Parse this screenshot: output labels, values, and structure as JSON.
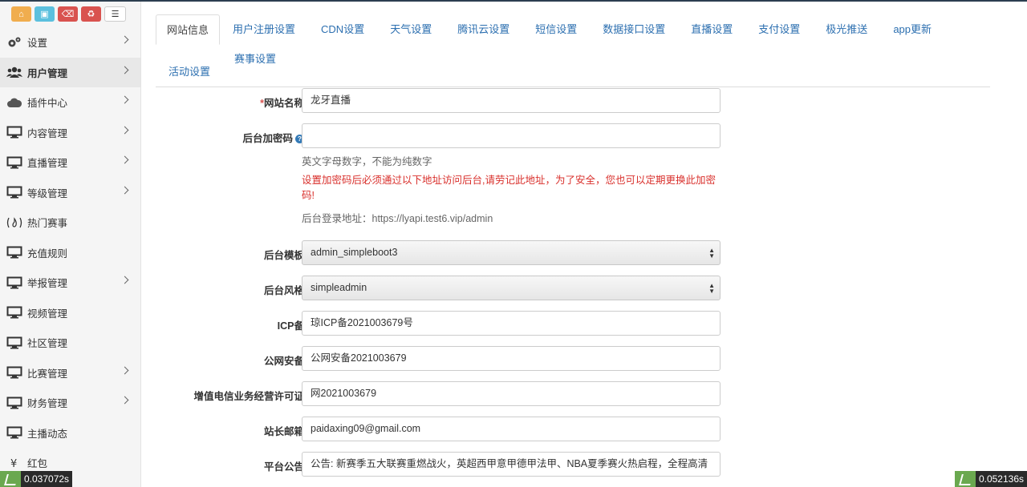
{
  "sidebar": {
    "items": [
      {
        "label": "设置",
        "icon": "gears-icon",
        "arrow": true,
        "active": false
      },
      {
        "label": "用户管理",
        "icon": "users-icon",
        "arrow": true,
        "active": true
      },
      {
        "label": "插件中心",
        "icon": "cloud-icon",
        "arrow": true,
        "active": false
      },
      {
        "label": "内容管理",
        "icon": "monitor-icon",
        "arrow": true,
        "active": false
      },
      {
        "label": "直播管理",
        "icon": "monitor-icon",
        "arrow": true,
        "active": false
      },
      {
        "label": "等级管理",
        "icon": "monitor-icon",
        "arrow": true,
        "active": false
      },
      {
        "label": "热门赛事",
        "icon": "fire-icon",
        "arrow": false,
        "active": false
      },
      {
        "label": "充值规则",
        "icon": "monitor-icon",
        "arrow": false,
        "active": false
      },
      {
        "label": "举报管理",
        "icon": "monitor-icon",
        "arrow": true,
        "active": false
      },
      {
        "label": "视频管理",
        "icon": "monitor-icon",
        "arrow": false,
        "active": false
      },
      {
        "label": "社区管理",
        "icon": "monitor-icon",
        "arrow": false,
        "active": false
      },
      {
        "label": "比赛管理",
        "icon": "monitor-icon",
        "arrow": true,
        "active": false
      },
      {
        "label": "财务管理",
        "icon": "monitor-icon",
        "arrow": true,
        "active": false
      },
      {
        "label": "主播动态",
        "icon": "monitor-icon",
        "arrow": false,
        "active": false
      },
      {
        "label": "红包",
        "icon": "yen-icon",
        "arrow": false,
        "active": false
      }
    ]
  },
  "tabs": [
    "网站信息",
    "用户注册设置",
    "CDN设置",
    "天气设置",
    "腾讯云设置",
    "短信设置",
    "数据接口设置",
    "直播设置",
    "支付设置",
    "极光推送",
    "app更新",
    "活动设置",
    "赛事设置"
  ],
  "form": {
    "site_name": {
      "required_mark": "*",
      "label": "网站名称",
      "value": "龙牙直播"
    },
    "admin_password": {
      "label": "后台加密码",
      "value": "",
      "help": "英文字母数字，不能为纯数字",
      "warning": "设置加密码后必须通过以下地址访问后台,请劳记此地址，为了安全，您也可以定期更换此加密码!",
      "login_url": "后台登录地址：https://lyapi.test6.vip/admin"
    },
    "admin_template": {
      "label": "后台模板",
      "value": "admin_simpleboot3"
    },
    "admin_style": {
      "label": "后台风格",
      "value": "simpleadmin"
    },
    "icp": {
      "label": "ICP备",
      "value": "琼ICP备2021003679号"
    },
    "police": {
      "label": "公网安备",
      "value": "公网安备2021003679"
    },
    "telecom": {
      "label": "增值电信业务经营许可证",
      "value": "网2021003679"
    },
    "email": {
      "label": "站长邮箱",
      "value": "paidaxing09@gmail.com"
    },
    "notice": {
      "label": "平台公告",
      "value": "公告: 新赛季五大联赛重燃战火，英超西甲意甲德甲法甲、NBA夏季赛火热启程，全程高清"
    }
  },
  "timers": {
    "left": "0.037072s",
    "right": "0.052136s"
  }
}
